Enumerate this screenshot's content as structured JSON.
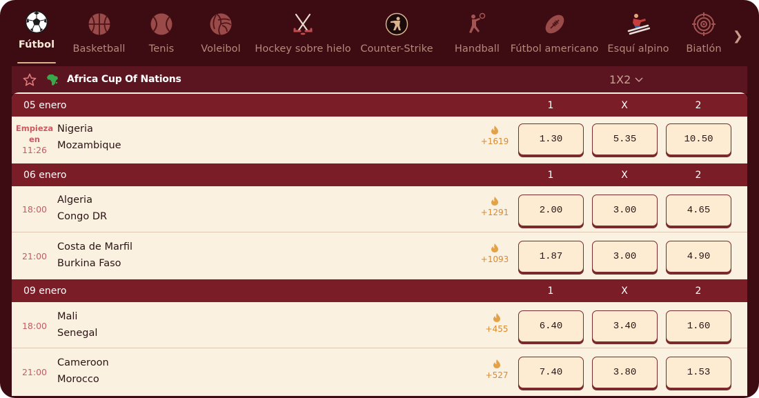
{
  "sports": [
    {
      "label": "Fútbol",
      "icon": "soccer-ball-icon",
      "active": true
    },
    {
      "label": "Basketball",
      "icon": "basketball-icon"
    },
    {
      "label": "Tenis",
      "icon": "tennis-ball-icon"
    },
    {
      "label": "Voleibol",
      "icon": "volleyball-icon"
    },
    {
      "label": "Hockey sobre hielo",
      "icon": "ice-hockey-icon"
    },
    {
      "label": "Counter-Strike",
      "icon": "counter-strike-icon"
    },
    {
      "label": "Handball",
      "icon": "handball-icon"
    },
    {
      "label": "Fútbol americano",
      "icon": "american-football-icon"
    },
    {
      "label": "Esquí alpino",
      "icon": "alpine-ski-icon"
    },
    {
      "label": "Biatlón",
      "icon": "biathlon-target-icon"
    }
  ],
  "league": {
    "name": "Africa Cup Of Nations",
    "market": "1X2"
  },
  "columns": [
    "1",
    "X",
    "2"
  ],
  "dates": [
    {
      "label": "05 enero",
      "matches": [
        {
          "time_lines": [
            "Empieza",
            "en",
            "11:26"
          ],
          "home": "Nigeria",
          "away": "Mozambique",
          "popularity": "+1619",
          "odds": [
            "1.30",
            "5.35",
            "10.50"
          ]
        }
      ]
    },
    {
      "label": "06 enero",
      "matches": [
        {
          "time_lines": [
            "18:00"
          ],
          "home": "Algeria",
          "away": "Congo DR",
          "popularity": "+1291",
          "odds": [
            "2.00",
            "3.00",
            "4.65"
          ]
        },
        {
          "time_lines": [
            "21:00"
          ],
          "home": "Costa de Marfil",
          "away": "Burkina Faso",
          "popularity": "+1093",
          "odds": [
            "1.87",
            "3.00",
            "4.90"
          ]
        }
      ]
    },
    {
      "label": "09 enero",
      "matches": [
        {
          "time_lines": [
            "18:00"
          ],
          "home": "Mali",
          "away": "Senegal",
          "popularity": "+455",
          "odds": [
            "6.40",
            "3.40",
            "1.60"
          ]
        },
        {
          "time_lines": [
            "21:00"
          ],
          "home": "Cameroon",
          "away": "Morocco",
          "popularity": "+527",
          "odds": [
            "7.40",
            "3.80",
            "1.53"
          ]
        }
      ]
    }
  ],
  "colors": {
    "frame_bg": "#3d0b12",
    "league_bg": "#5b1520",
    "date_bar": "#7a1d27",
    "panel_bg": "#fbf1e1",
    "odd_bg": "#fdebd2",
    "time_color": "#c75b61",
    "popularity_color": "#d88a30"
  }
}
